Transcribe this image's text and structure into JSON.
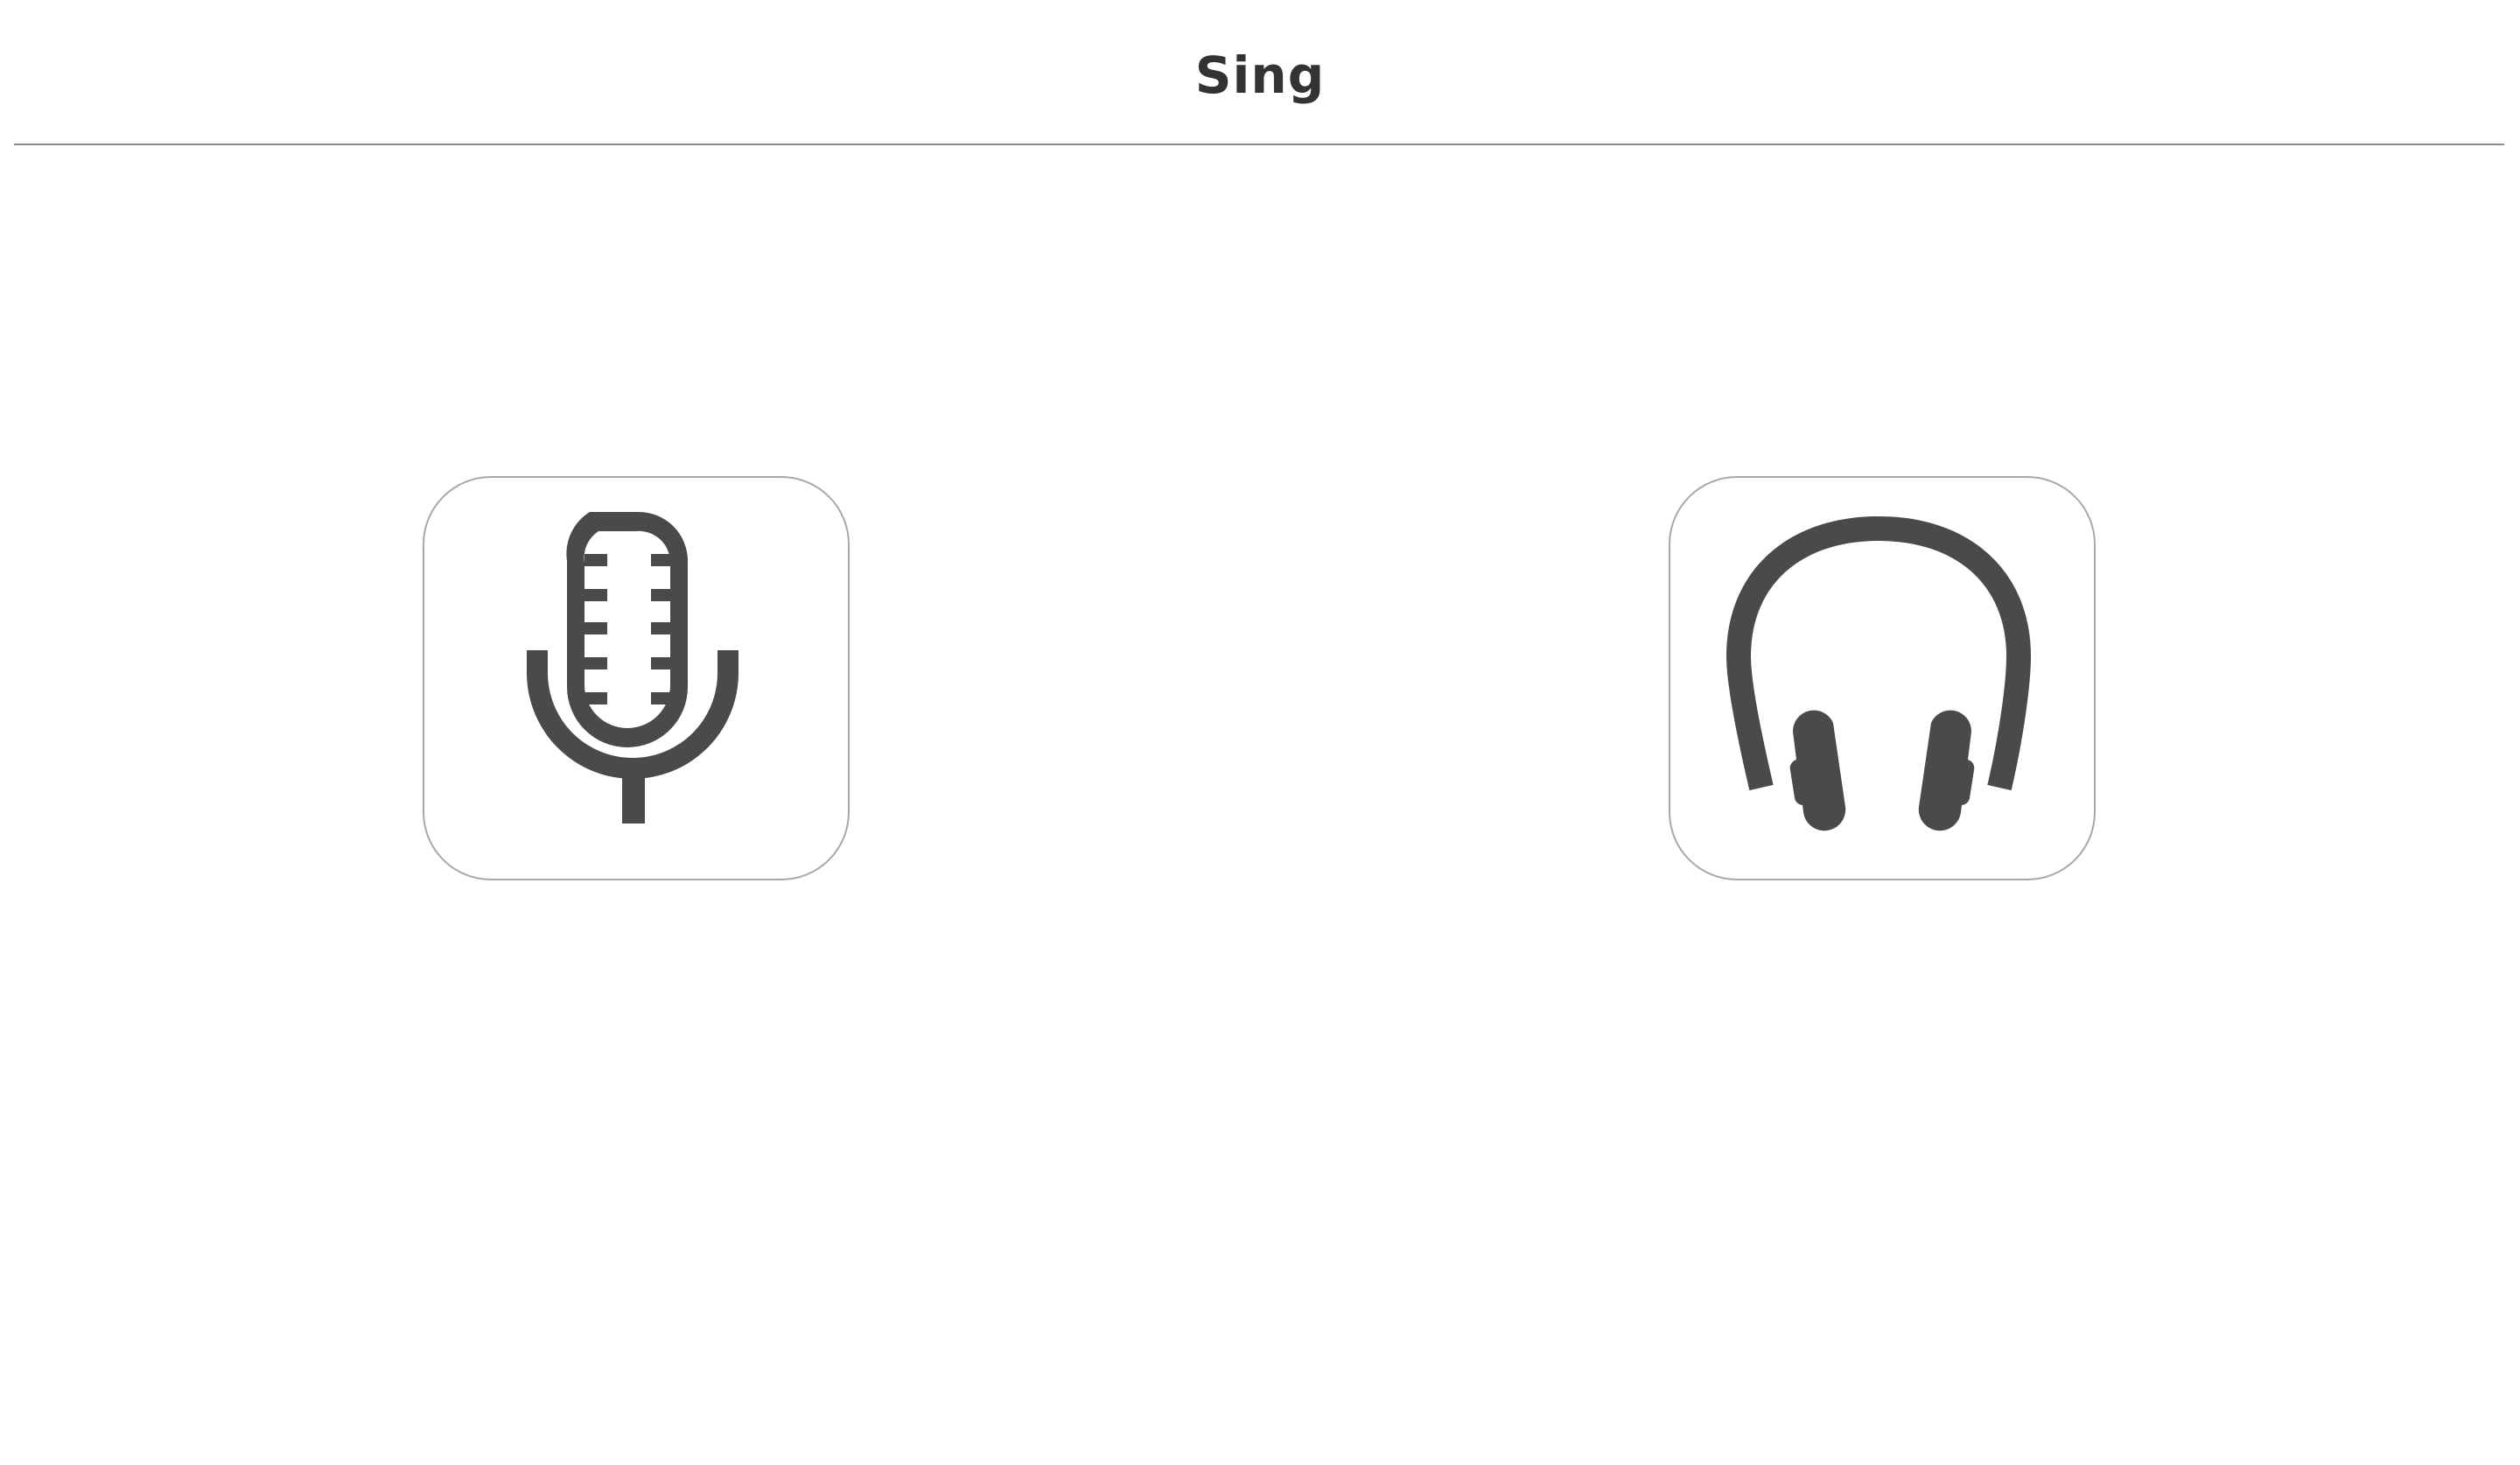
{
  "header": {
    "title": "Sing"
  },
  "actions": [
    {
      "id": "record",
      "icon": "microphone-icon"
    },
    {
      "id": "listen",
      "icon": "headphones-icon"
    }
  ],
  "colors": {
    "icon": "#4a4a4a",
    "tile_border": "#a8a8a8",
    "divider": "#8c8c8c",
    "title": "#333333",
    "background": "#ffffff"
  }
}
